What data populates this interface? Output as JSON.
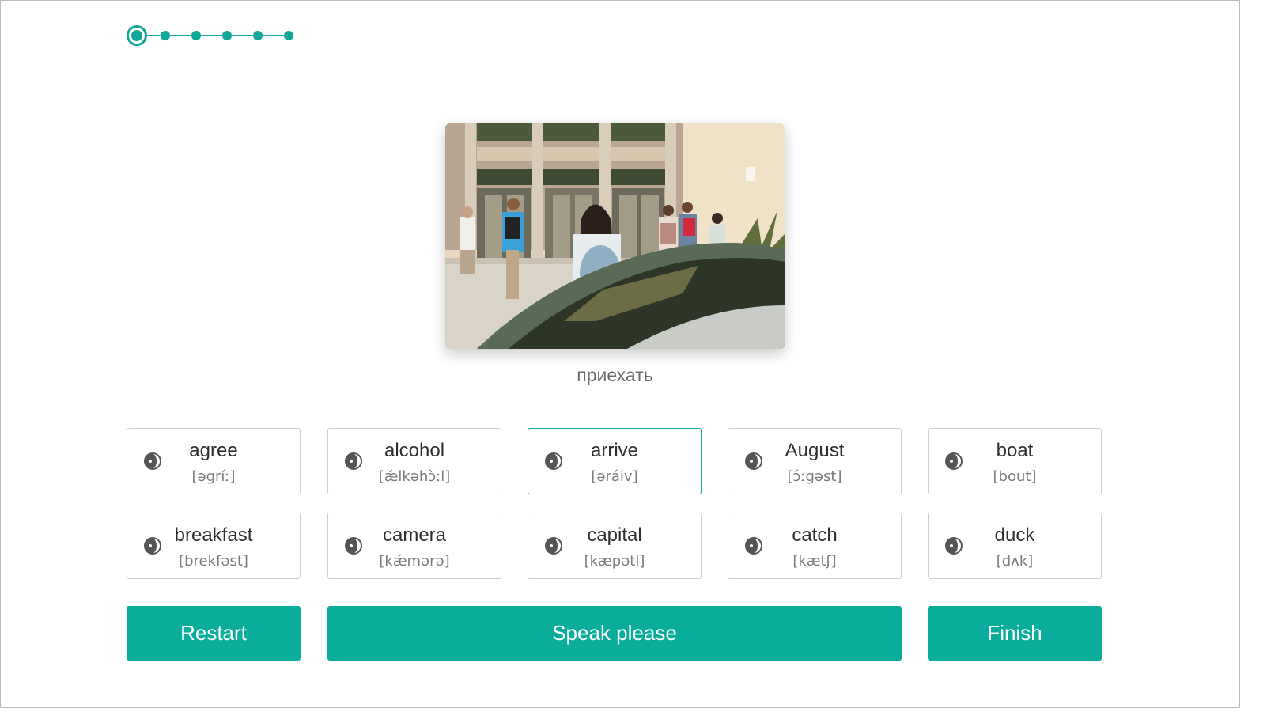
{
  "progress": {
    "steps": 6,
    "current": 1
  },
  "image": {
    "icon": "photo-students-entering-school"
  },
  "translation": "приехать",
  "cards": [
    {
      "word": "agree",
      "transcription": "[əgríː]",
      "selected": false
    },
    {
      "word": "alcohol",
      "transcription": "[ǽlkəhɔ̀ːl]",
      "selected": false
    },
    {
      "word": "arrive",
      "transcription": "[əráiv]",
      "selected": true
    },
    {
      "word": "August",
      "transcription": "[ɔ́ːgəst]",
      "selected": false
    },
    {
      "word": "boat",
      "transcription": "[bout]",
      "selected": false
    },
    {
      "word": "breakfast",
      "transcription": "[brekfəst]",
      "selected": false
    },
    {
      "word": "camera",
      "transcription": "[kǽmərə]",
      "selected": false
    },
    {
      "word": "capital",
      "transcription": "[kæpətl]",
      "selected": false
    },
    {
      "word": "catch",
      "transcription": "[kætʃ]",
      "selected": false
    },
    {
      "word": "duck",
      "transcription": "[dʌk]",
      "selected": false
    }
  ],
  "card_icon": "ear-icon",
  "buttons": {
    "restart": "Restart",
    "speak": "Speak please",
    "finish": "Finish"
  },
  "colors": {
    "accent": "#0aac9b",
    "border": "#cfcfcf",
    "text": "#2e2e2e"
  }
}
